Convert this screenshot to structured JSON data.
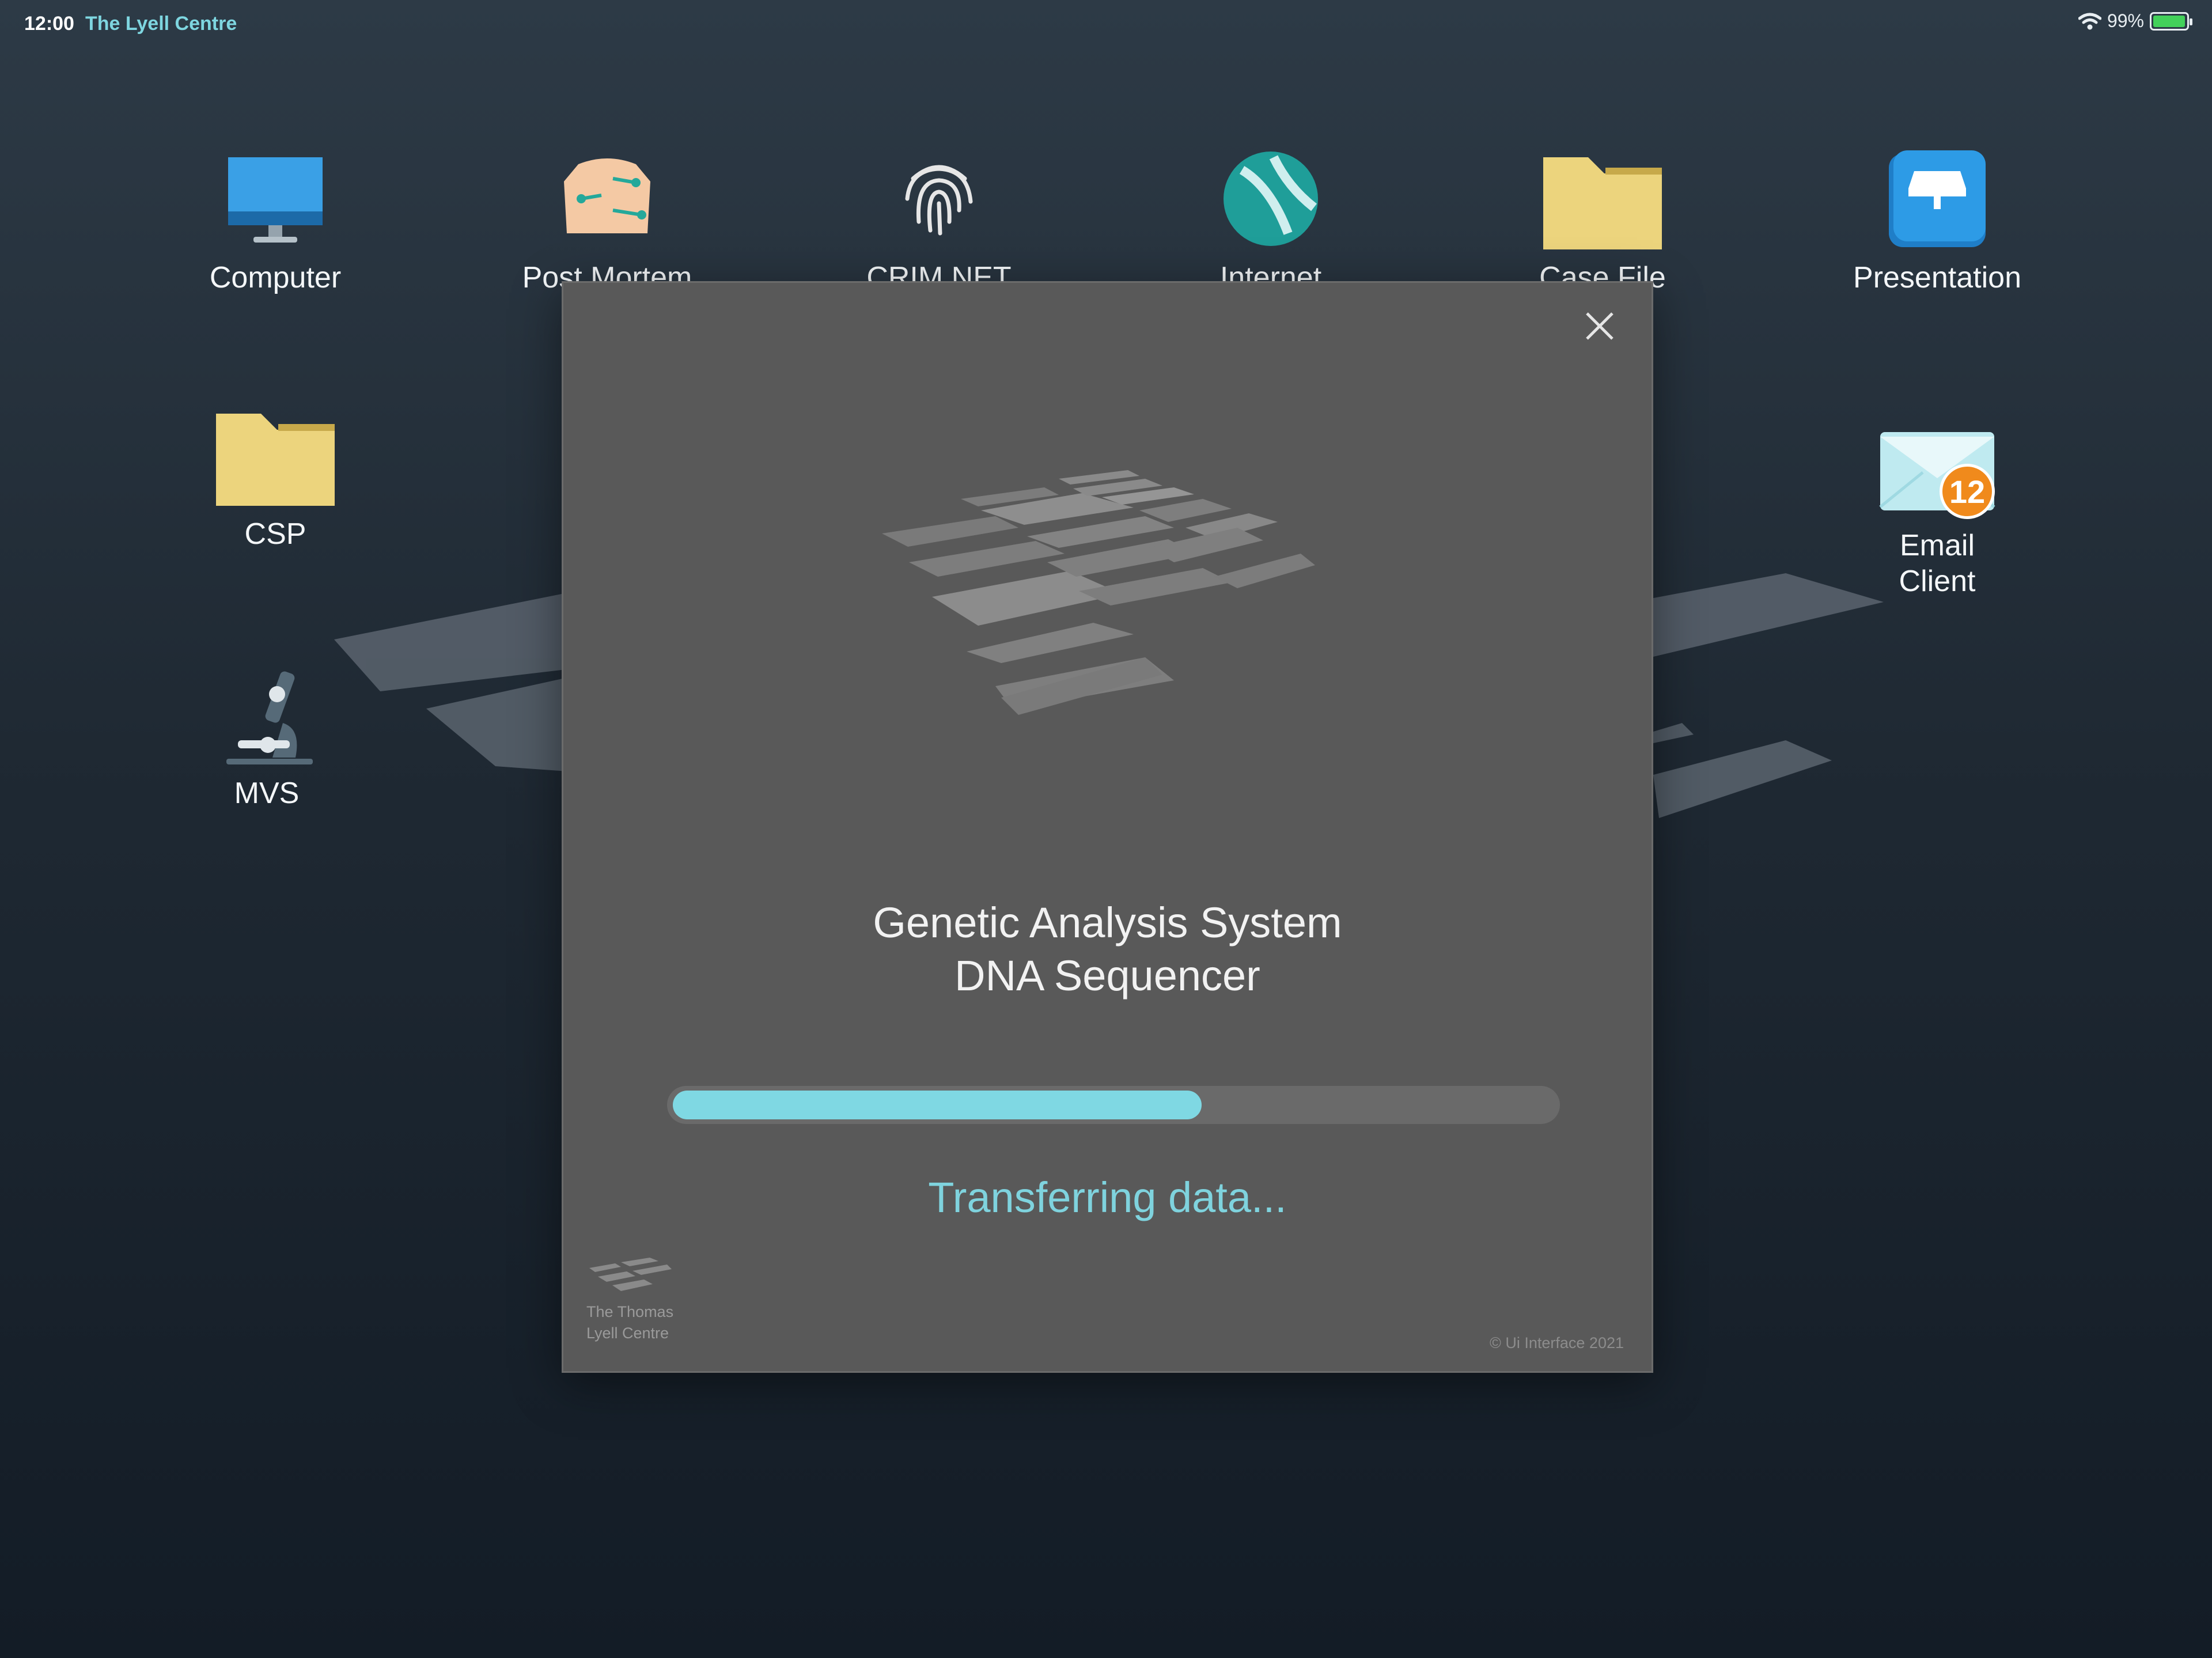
{
  "status_bar": {
    "time": "12:00",
    "organization": "The Lyell Centre",
    "battery": "99%",
    "battery_level": 0.99,
    "icons": [
      "wifi-icon",
      "battery-icon"
    ]
  },
  "desktop": {
    "icons": [
      {
        "label": "Computer",
        "icon": "monitor-icon"
      },
      {
        "label": "Post Mortem",
        "icon": "body-icon"
      },
      {
        "label": "CRIM NET",
        "icon": "fingerprint-icon"
      },
      {
        "label": "Internet",
        "icon": "globe-icon"
      },
      {
        "label": "Case File",
        "icon": "folder-icon"
      },
      {
        "label": "Presentation",
        "icon": "presentation-icon"
      },
      {
        "label": "CSP",
        "icon": "folder-icon"
      },
      {
        "label": "Email Client",
        "icon": "mail-icon",
        "badge": "12"
      },
      {
        "label": "MVS",
        "icon": "microscope-icon"
      }
    ]
  },
  "dialog": {
    "title_line1": "Genetic Analysis System",
    "title_line2": "DNA Sequencer",
    "progress": 0.6,
    "status": "Transferring data...",
    "footer_org_line1": "The Thomas",
    "footer_org_line2": "Lyell Centre",
    "copyright": "© Ui Interface 2021",
    "close_icon": "close-icon"
  },
  "colors": {
    "accent": "#7fd8e3",
    "dialog_bg": "#595959",
    "battery": "#43d15a",
    "badge": "#f08a1c"
  }
}
